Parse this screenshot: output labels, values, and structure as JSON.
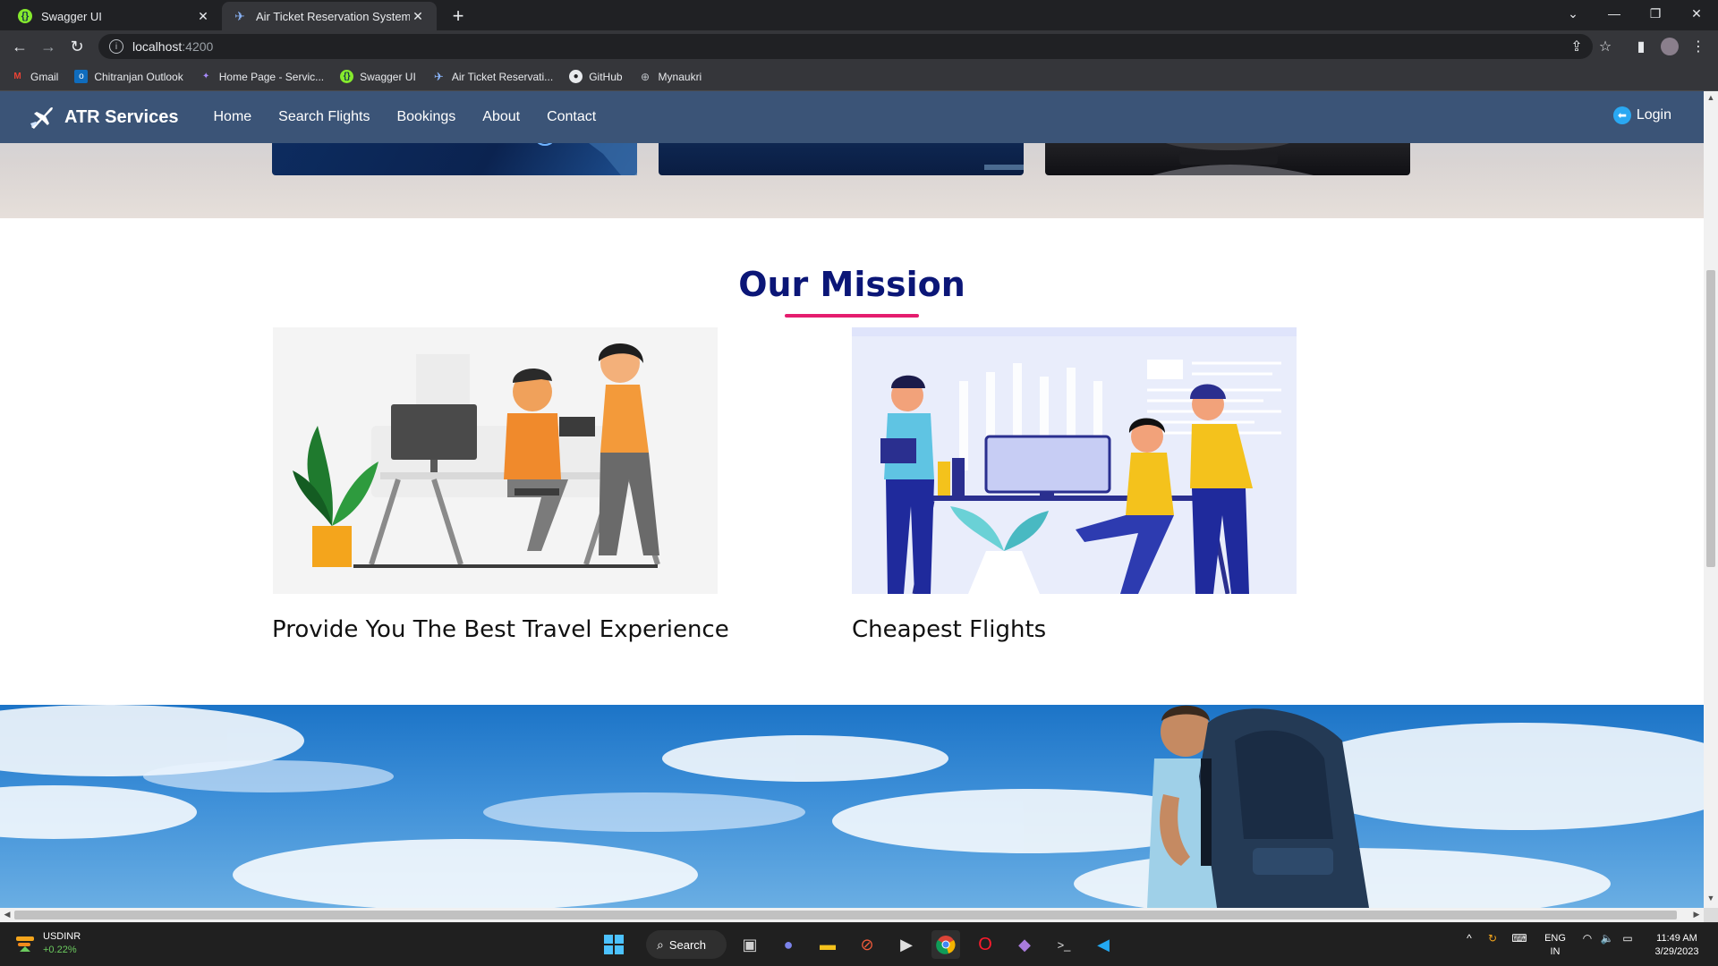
{
  "browser": {
    "tabs": [
      {
        "title": "Swagger UI",
        "active": false
      },
      {
        "title": "Air Ticket Reservation System",
        "active": true
      }
    ],
    "url_host": "localhost",
    "url_port": ":4200",
    "bookmarks": [
      {
        "label": "Gmail",
        "icon": "gmail-icon"
      },
      {
        "label": "Chitranjan Outlook",
        "icon": "outlook-icon"
      },
      {
        "label": "Home Page - Servic...",
        "icon": "servicenow-icon"
      },
      {
        "label": "Swagger UI",
        "icon": "swagger-icon"
      },
      {
        "label": "Air Ticket Reservati...",
        "icon": "plane-icon"
      },
      {
        "label": "GitHub",
        "icon": "github-icon"
      },
      {
        "label": "Mynaukri",
        "icon": "globe-icon"
      }
    ]
  },
  "site": {
    "brand": "ATR Services",
    "nav": [
      "Home",
      "Search Flights",
      "Bookings",
      "About",
      "Contact"
    ],
    "login": "Login",
    "colors": {
      "navbar": "#3b5477",
      "mission_title": "#0b1677",
      "underline": "#e51d6e"
    }
  },
  "mission": {
    "title": "Our Mission",
    "cards": [
      {
        "title": "Provide You The Best Travel Experience",
        "image": "team-at-desk-illustration"
      },
      {
        "title": "Cheapest Flights",
        "image": "office-teamwork-illustration"
      }
    ]
  },
  "taskbar": {
    "widget_symbol": "USDINR",
    "widget_change": "+0.22%",
    "search_label": "Search",
    "lang_line1": "ENG",
    "lang_line2": "IN",
    "time": "11:49 AM",
    "date": "3/29/2023"
  }
}
